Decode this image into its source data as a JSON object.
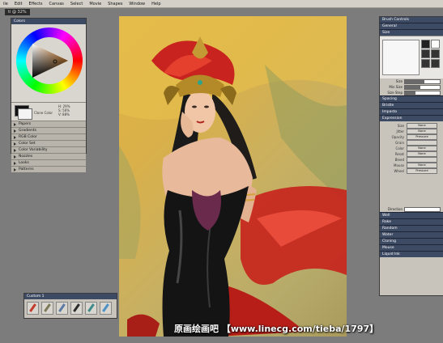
{
  "menubar": {
    "items": [
      "ile",
      "Edit",
      "Effects",
      "Canvas",
      "Select",
      "Movie",
      "Shapes",
      "Window",
      "Help"
    ]
  },
  "document": {
    "tab_label": "ti  @ 32%"
  },
  "colors_panel": {
    "title": "Colors",
    "readout": [
      "H: 29%",
      "S: 56%",
      "V: 88%"
    ],
    "clone_color": "Clone Color",
    "rows": [
      "Papers",
      "Gradients",
      "RGB Color",
      "Color Set",
      "Color Variability",
      "Nozzles",
      "Looks",
      "Patterns"
    ]
  },
  "brush_panel": {
    "title": "Brush Controls",
    "sections_top": [
      "General",
      "Size"
    ],
    "sliders": [
      {
        "label": "Size",
        "fill": 0.55
      },
      {
        "label": "Min Size",
        "fill": 0.45
      },
      {
        "label": "Size Step",
        "fill": 0.3
      }
    ],
    "sections_mid": [
      "Spacing",
      "Bristle",
      "Impasto",
      "Expression"
    ],
    "expression_header": "Expression",
    "expression": [
      {
        "label": "Size",
        "value": "None"
      },
      {
        "label": "Jitter",
        "value": "None"
      },
      {
        "label": "Opacity",
        "value": "Pressure"
      },
      {
        "label": "Grain",
        "value": ""
      },
      {
        "label": "Color",
        "value": "None"
      },
      {
        "label": "Resat",
        "value": "None"
      },
      {
        "label": "Bleed",
        "value": ""
      },
      {
        "label": "Mouse",
        "value": "None"
      },
      {
        "label": "Wheel",
        "value": "Pressure"
      }
    ],
    "direction_label": "Direction",
    "sections_bottom": [
      "Well",
      "Rake",
      "Random",
      "Water",
      "Cloning",
      "Mouse",
      "Liquid Ink"
    ]
  },
  "toolbox": {
    "title": "Custom 1",
    "tools": [
      {
        "icon": "eraser-icon",
        "color": "#c23b2b"
      },
      {
        "icon": "pencil-icon",
        "color": "#7d7a58"
      },
      {
        "icon": "brush-icon",
        "color": "#5b7aa4"
      },
      {
        "icon": "marker-icon",
        "color": "#2c2c2c"
      },
      {
        "icon": "pen-icon",
        "color": "#3f8b8b"
      },
      {
        "icon": "blender-icon",
        "color": "#4a91c6"
      }
    ]
  },
  "watermark": "原画绘画吧 【www.linecg.com/tieba/1797】"
}
